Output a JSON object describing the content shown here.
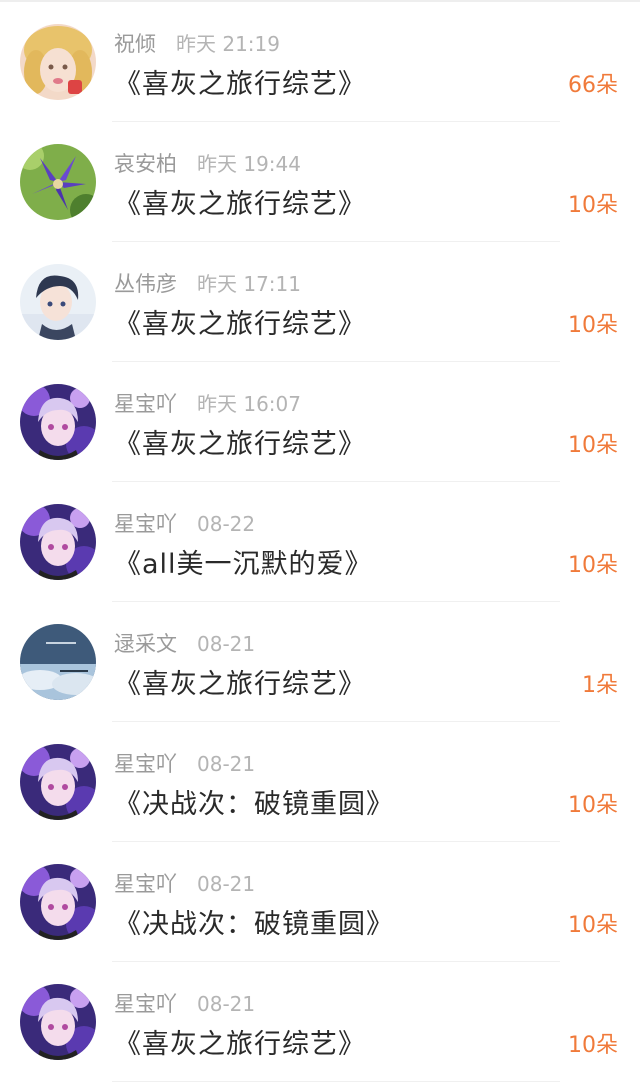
{
  "gift_list": [
    {
      "user": "祝倾",
      "time": "昨天 21:19",
      "work": "《喜灰之旅行综艺》",
      "count": "66朵",
      "avatar": "avatar-blonde-girl"
    },
    {
      "user": "哀安柏",
      "time": "昨天 19:44",
      "work": "《喜灰之旅行综艺》",
      "count": "10朵",
      "avatar": "avatar-purple-flower"
    },
    {
      "user": "丛伟彦",
      "time": "昨天 17:11",
      "work": "《喜灰之旅行综艺》",
      "count": "10朵",
      "avatar": "avatar-anime-boy"
    },
    {
      "user": "星宝吖",
      "time": "昨天 16:07",
      "work": "《喜灰之旅行综艺》",
      "count": "10朵",
      "avatar": "avatar-anime-girl-purple"
    },
    {
      "user": "星宝吖",
      "time": "08-22",
      "work": "《all美一沉默的爱》",
      "count": "10朵",
      "avatar": "avatar-anime-girl-purple"
    },
    {
      "user": "逯采文",
      "time": "08-21",
      "work": "《喜灰之旅行综艺》",
      "count": "1朵",
      "avatar": "avatar-sky"
    },
    {
      "user": "星宝吖",
      "time": "08-21",
      "work": "《决战次：破镜重圆》",
      "count": "10朵",
      "avatar": "avatar-anime-girl-purple"
    },
    {
      "user": "星宝吖",
      "time": "08-21",
      "work": "《决战次：破镜重圆》",
      "count": "10朵",
      "avatar": "avatar-anime-girl-purple"
    },
    {
      "user": "星宝吖",
      "time": "08-21",
      "work": "《喜灰之旅行综艺》",
      "count": "10朵",
      "avatar": "avatar-anime-girl-purple"
    }
  ],
  "colors": {
    "count_orange": "#f07a3a",
    "meta_gray": "#9a9a9a",
    "title_dark": "#2a2a2a"
  }
}
